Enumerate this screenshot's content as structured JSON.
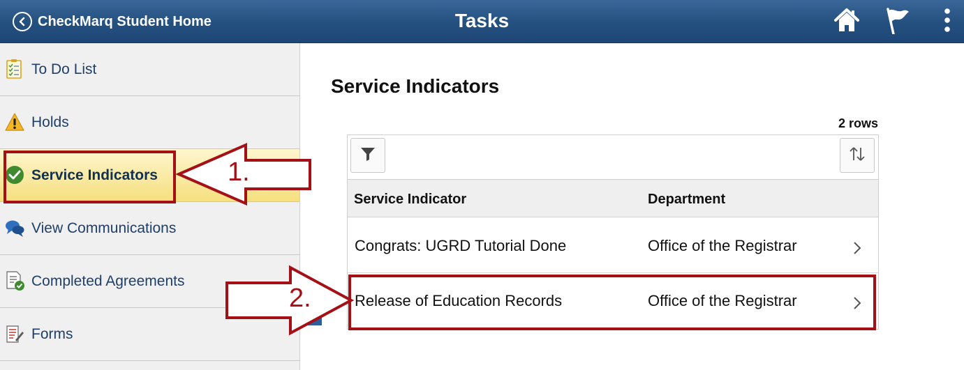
{
  "header": {
    "back_label": "CheckMarq Student Home",
    "title": "Tasks",
    "icons": [
      "home-icon",
      "flag-icon",
      "more-vertical-icon"
    ]
  },
  "sidebar": {
    "items": [
      {
        "label": "To Do List",
        "icon": "checklist-icon"
      },
      {
        "label": "Holds",
        "icon": "warning-icon"
      },
      {
        "label": "Service Indicators",
        "icon": "check-circle-icon",
        "active": true
      },
      {
        "label": "View Communications",
        "icon": "chat-bubbles-icon"
      },
      {
        "label": "Completed Agreements",
        "icon": "document-check-icon"
      },
      {
        "label": "Forms",
        "icon": "form-icon"
      }
    ]
  },
  "main": {
    "title": "Service Indicators",
    "row_count": "2 rows",
    "columns": [
      "Service Indicator",
      "Department"
    ],
    "rows": [
      {
        "indicator": "Congrats: UGRD Tutorial Done",
        "department": "Office of the Registrar"
      },
      {
        "indicator": "Release of Education Records",
        "department": "Office of the Registrar"
      }
    ]
  },
  "annotations": {
    "step1": "1.",
    "step2": "2.",
    "color": "#a50f16"
  },
  "colors": {
    "header": "#24507f",
    "active_nav": "#f5df7e",
    "nav_text": "#1f3f68"
  }
}
